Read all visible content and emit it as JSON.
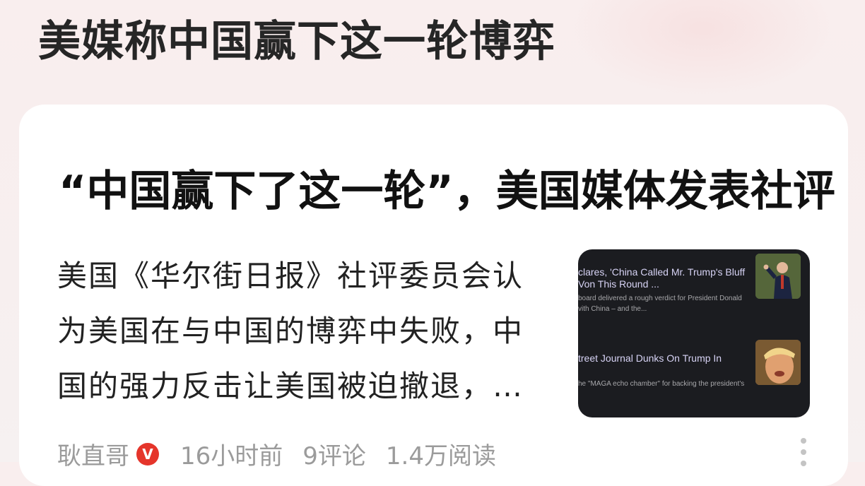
{
  "topic": {
    "title": "美媒称中国赢下这一轮博弈"
  },
  "article": {
    "headline": "“中国赢下了这一轮”，美国媒体发表社评",
    "summary_lines": [
      "美国《华尔街日报》社评委员会认",
      "为美国在与中国的博弈中失败，中",
      "国的强力反击让美国被迫撤退，…"
    ],
    "thumbnail": {
      "item1_headline_line1": "clares, 'China Called Mr. Trump's Bluff",
      "item1_headline_line2": "Von This Round ...",
      "item1_sub_line1": "board delivered a rough verdict for President Donald",
      "item1_sub_line2": "vith China – and the...",
      "item2_headline": "treet Journal Dunks On Trump In",
      "item2_sub": "he \"MAGA echo chamber\" for backing the president's"
    },
    "meta": {
      "author": "耿直哥",
      "verified_badge": "V",
      "time": "16小时前",
      "comments": "9评论",
      "reads": "1.4万阅读"
    }
  },
  "colors": {
    "verified_badge": "#e5352b",
    "thumbnail_bg": "#1b1c20"
  }
}
